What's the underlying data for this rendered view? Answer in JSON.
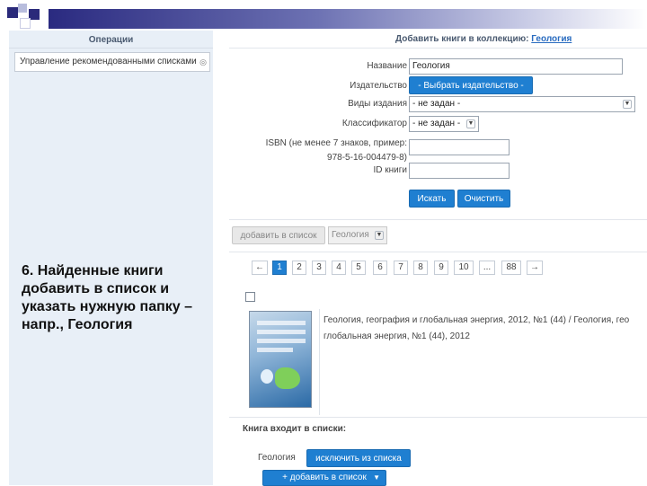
{
  "left": {
    "operations_header": "Операции",
    "operations_select": "Управление рекомендованными списками"
  },
  "right": {
    "add_header_prefix": "Добавить книги в коллекцию:",
    "add_header_link": "Геология",
    "form": {
      "name_label": "Название",
      "name_value": "Геология",
      "publisher_label": "Издательство",
      "publisher_button": "- Выбрать издательство -",
      "edition_type_label": "Виды издания",
      "edition_type_value": "- не задан -",
      "classifier_label": "Классификатор",
      "classifier_value": "- не задан -",
      "isbn_label_line1": "ISBN (не менее 7 знаков, пример:",
      "isbn_label_line2": "978-5-16-004479-8)",
      "isbn_value": "",
      "book_id_label": "ID книги",
      "book_id_value": "",
      "search_button": "Искать",
      "clear_button": "Очистить"
    },
    "add_to_list_button": "добавить в список",
    "folder_select_value": "Геология",
    "pagination": {
      "prev": "←",
      "pages": [
        "1",
        "2",
        "3",
        "4",
        "5",
        "6",
        "7",
        "8",
        "9",
        "10",
        "...",
        "88"
      ],
      "next": "→",
      "active": "1"
    },
    "book": {
      "title_line1": "Геология, география и глобальная энергия, 2012, №1 (44) / Геология, гео",
      "title_line2": "глобальная энергия, №1 (44), 2012"
    },
    "lists_label": "Книга входит в списки:",
    "list_name": "Геология",
    "remove_button": "исключить из списка",
    "add_list_button": "+ добавить в список"
  },
  "annotation": "6. Найденные книги добавить в список и указать нужную папку – напр., Геология",
  "colors": {
    "accent": "#1f7fd1",
    "left_panel_bg": "#e8eff7",
    "title_bar_dark": "#2a2a80"
  }
}
